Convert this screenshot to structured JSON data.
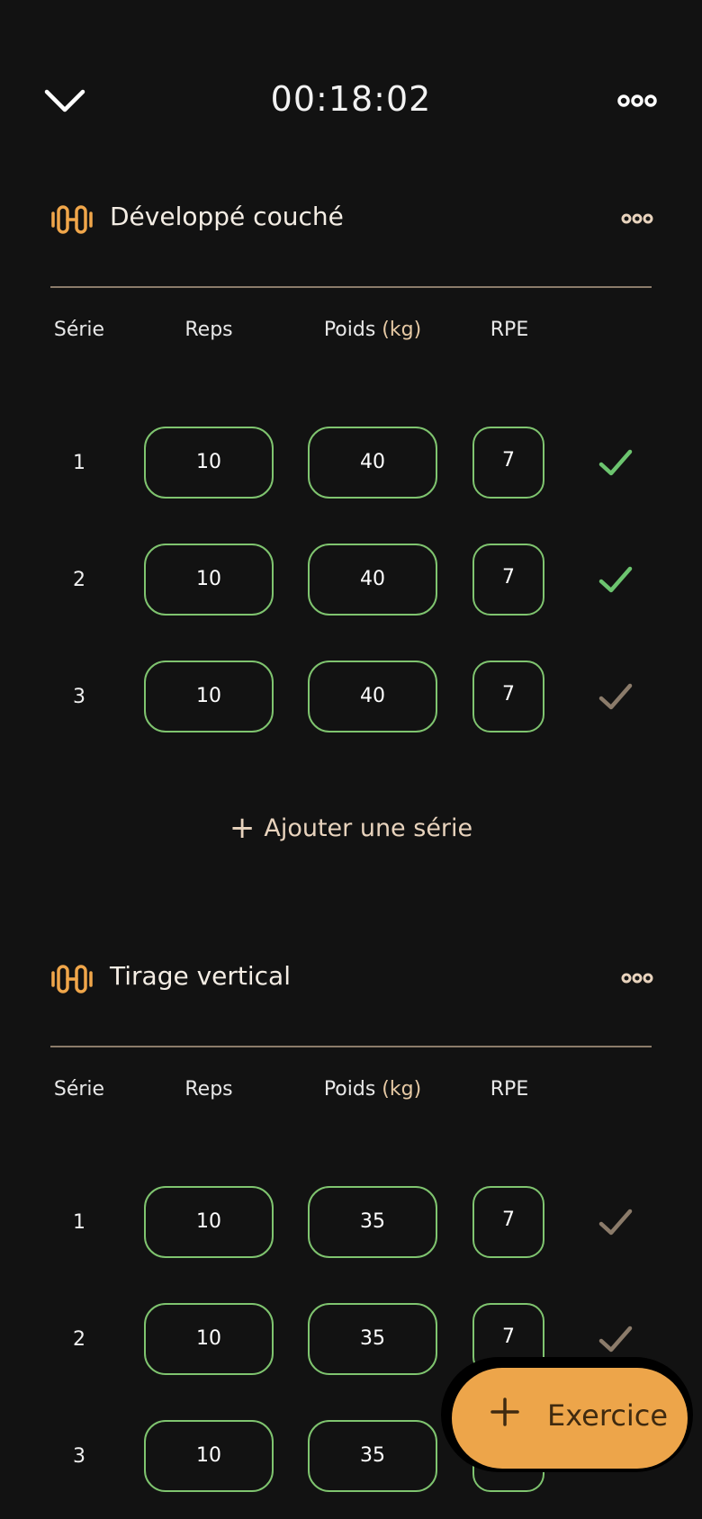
{
  "header": {
    "timer": "00:18:02",
    "collapse_icon": "chevron-down-icon",
    "menu_icon": "more-horizontal-icon"
  },
  "columns": {
    "serie": "Série",
    "reps": "Reps",
    "poids": "Poids",
    "unit": "(kg)",
    "rpe": "RPE"
  },
  "exercises": [
    {
      "name": "Développé couché",
      "icon": "dumbbell-icon",
      "sets": [
        {
          "num": "1",
          "reps": "10",
          "poids": "40",
          "rpe": "7",
          "done": true
        },
        {
          "num": "2",
          "reps": "10",
          "poids": "40",
          "rpe": "7",
          "done": true
        },
        {
          "num": "3",
          "reps": "10",
          "poids": "40",
          "rpe": "7",
          "done": false
        }
      ],
      "add_set_label": "Ajouter une série"
    },
    {
      "name": "Tirage vertical",
      "icon": "dumbbell-icon",
      "sets": [
        {
          "num": "1",
          "reps": "10",
          "poids": "35",
          "rpe": "7",
          "done": false
        },
        {
          "num": "2",
          "reps": "10",
          "poids": "35",
          "rpe": "7",
          "done": false
        },
        {
          "num": "3",
          "reps": "10",
          "poids": "35",
          "rpe": "",
          "done": false
        }
      ]
    }
  ],
  "fab": {
    "label": "Exercice"
  },
  "colors": {
    "background": "#121212",
    "accent_orange": "#eda54a",
    "field_border_green": "#7fc46f",
    "check_done": "#6cc46f",
    "check_pending": "#8b7b6a"
  }
}
